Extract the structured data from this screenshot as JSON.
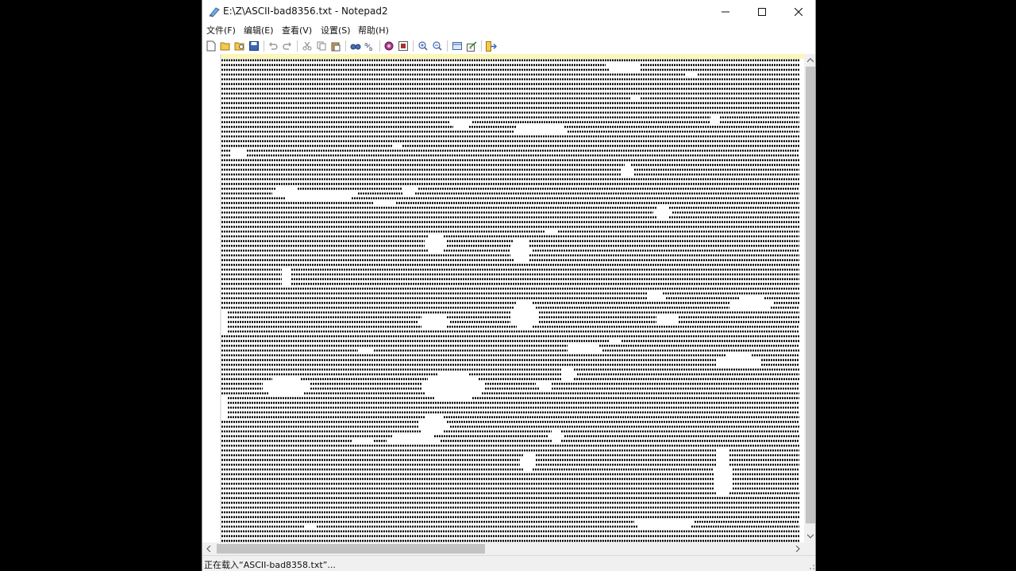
{
  "window": {
    "title": "E:\\Z\\ASCII-bad8356.txt - Notepad2"
  },
  "menu": [
    {
      "label": "文件(F)"
    },
    {
      "label": "编辑(E)"
    },
    {
      "label": "查看(V)"
    },
    {
      "label": "设置(S)"
    },
    {
      "label": "帮助(H)"
    }
  ],
  "toolbar": {
    "buttons": [
      "new-icon",
      "open-icon",
      "browse-icon",
      "save-icon",
      "undo-icon",
      "redo-icon",
      "cut-icon",
      "copy-icon",
      "paste-icon",
      "find-icon",
      "replace-icon",
      "wordwrap-icon",
      "schemes-icon",
      "zoom-in-icon",
      "zoom-out-icon",
      "view-icon",
      "settings-icon",
      "exit-icon"
    ]
  },
  "editor": {
    "content": "ASCII art frame rendered with dense character lines",
    "background": "#ffffff",
    "text_color": "#000000",
    "caret_line_color": "#fbf7b8"
  },
  "status": {
    "text": "正在载入“ASCII-bad8358.txt”..."
  }
}
